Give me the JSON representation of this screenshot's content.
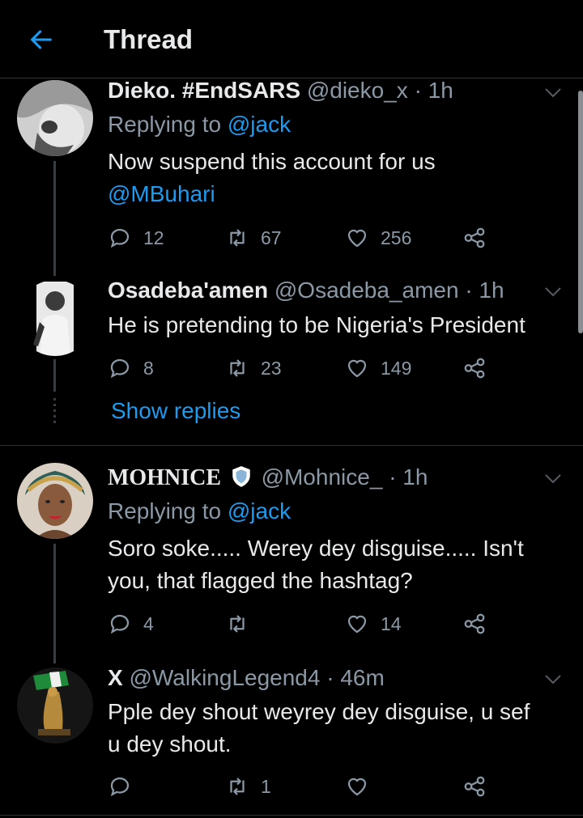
{
  "header": {
    "title": "Thread"
  },
  "tweets": [
    {
      "display_name": "Dieko. #EndSARS",
      "handle": "@dieko_x",
      "time": "· 1h",
      "replying_prefix": "Replying to",
      "replying_to": "@jack",
      "text_line1": "Now suspend this account for us",
      "text_line2": "@MBuhari",
      "replies": "12",
      "retweets": "67",
      "likes": "256"
    },
    {
      "display_name": "Osadeba'amen",
      "handle": "@Osadeba_amen",
      "time": "· 1h",
      "text": "He is pretending to be Nigeria's President",
      "replies": "8",
      "retweets": "23",
      "likes": "149"
    },
    {
      "display_name": "MOHNICE",
      "handle": "@Mohnice_",
      "time": "· 1h",
      "replying_prefix": "Replying to",
      "replying_to": "@jack",
      "text_line1": "Soro soke..... Werey dey disguise..... Isn't",
      "text_line2": "you, that flagged the hashtag?",
      "replies": "4",
      "retweets": "",
      "likes": "14"
    },
    {
      "display_name": "X",
      "handle": "@WalkingLegend4",
      "time": "· 46m",
      "text_line1": "Pple dey shout weyrey dey disguise, u sef",
      "text_line2": "u dey shout.",
      "replies": "",
      "retweets": "1",
      "likes": ""
    }
  ],
  "show_replies": "Show replies",
  "colors": {
    "background": "#000000",
    "accent": "#1d9bf0",
    "muted": "#8b98a5",
    "text": "#e7e9ea"
  }
}
